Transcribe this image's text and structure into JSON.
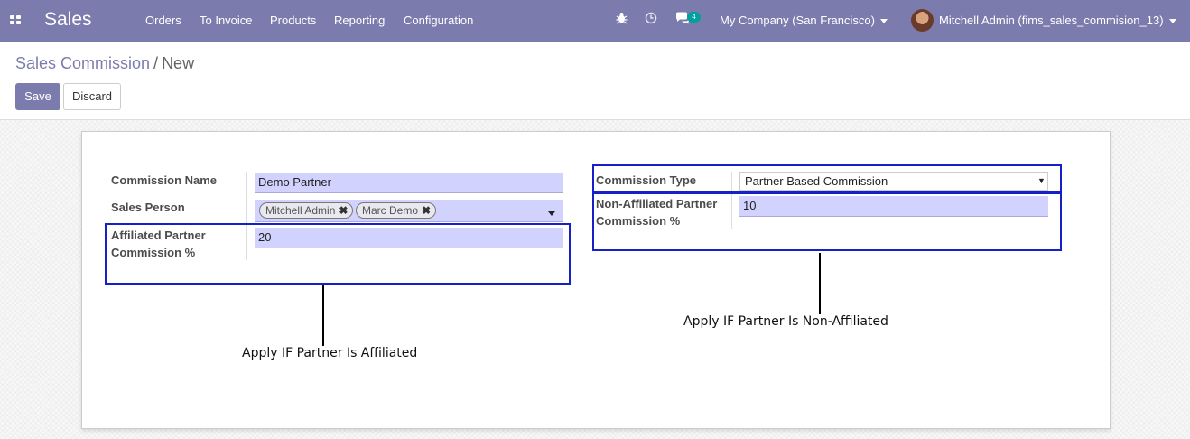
{
  "navbar": {
    "apps_icon": "apps-grid-icon",
    "brand": "Sales",
    "menu": [
      "Orders",
      "To Invoice",
      "Products",
      "Reporting",
      "Configuration"
    ],
    "debug_icon": "bug-icon",
    "activity_icon": "clock-icon",
    "messages_icon": "chat-icon",
    "messages_count": "4",
    "company": "My Company (San Francisco)",
    "user": "Mitchell Admin (fims_sales_commision_13)"
  },
  "breadcrumb": {
    "parent": "Sales Commission",
    "separator": "/",
    "current": "New"
  },
  "buttons": {
    "save": "Save",
    "discard": "Discard"
  },
  "form": {
    "commission_name": {
      "label": "Commission Name",
      "value": "Demo Partner"
    },
    "sales_person": {
      "label": "Sales Person",
      "tags": [
        "Mitchell Admin",
        "Marc Demo"
      ],
      "remove_glyph": "✖"
    },
    "affiliated": {
      "label_line1": "Affiliated Partner",
      "label_line2": "Commission %",
      "value": "20"
    },
    "commission_type": {
      "label": "Commission Type",
      "value": "Partner Based Commission",
      "caret": "▼"
    },
    "non_affiliated": {
      "label_line1": "Non-Affiliated Partner",
      "label_line2": "Commission %",
      "value": "10"
    }
  },
  "annotations": {
    "affiliated": "Apply IF Partner Is Affiliated",
    "non_affiliated": "Apply IF Partner Is Non-Affiliated",
    "highlight_color": "#1520c9"
  },
  "colors": {
    "brand": "#7c7bad",
    "field_bg": "#d2d2ff",
    "badge": "#00a09d"
  }
}
